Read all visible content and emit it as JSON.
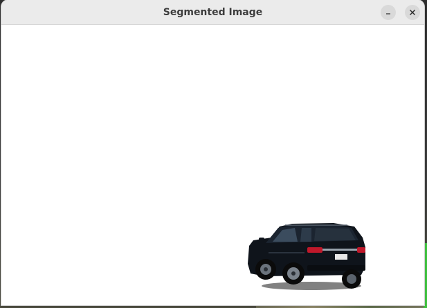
{
  "window": {
    "title": "Segmented Image",
    "controls": {
      "minimize_icon": "minimize-icon",
      "close_icon": "close-icon"
    }
  },
  "content": {
    "background": "#ffffff",
    "segmented_object": "car"
  },
  "colors": {
    "titlebar": "#ebebeb",
    "title_text": "#3d3d3d",
    "control_bg": "#d9d9d9"
  }
}
